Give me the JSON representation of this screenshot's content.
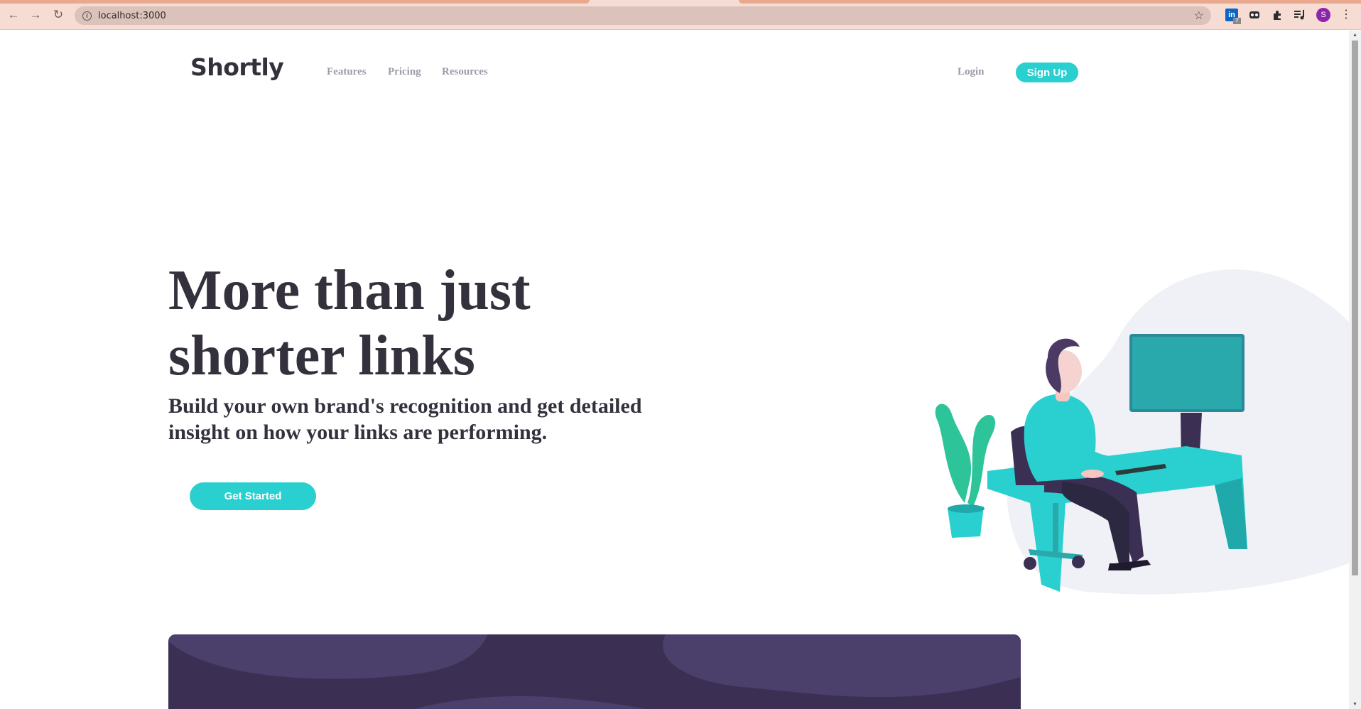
{
  "browser": {
    "url": "localhost:3000",
    "profile_initial": "S",
    "linkedin_label": "in",
    "linkedin_badge": "7"
  },
  "site": {
    "logo": "Shortly",
    "nav": {
      "features": "Features",
      "pricing": "Pricing",
      "resources": "Resources",
      "login": "Login",
      "signup": "Sign Up"
    },
    "hero": {
      "title_line1": "More than just",
      "title_line2": "shorter links",
      "subtitle": "Build your own brand's recognition and get detailed insight on how your links are performing.",
      "cta": "Get Started"
    }
  },
  "colors": {
    "brand_cyan": "#2acfcf",
    "dark_violet": "#3b3054",
    "heading": "#34313d",
    "nav_gray": "#9e9aa7"
  },
  "icons": [
    "back-arrow-icon",
    "forward-arrow-icon",
    "reload-icon",
    "info-icon",
    "star-icon",
    "puzzle-icon",
    "media-control-icon",
    "more-menu-icon"
  ]
}
